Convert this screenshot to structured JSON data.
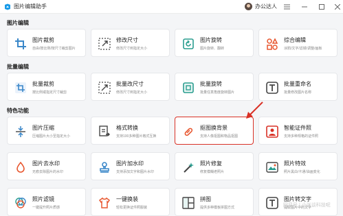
{
  "app": {
    "title": "图片编辑助手",
    "user": "办公达人"
  },
  "colors": {
    "accent": "#e8562e",
    "highlight": "#d93025"
  },
  "sections": [
    {
      "title": "图片编辑",
      "items": [
        {
          "title": "图片裁剪",
          "desc": "自由/按比例/按尺寸裁剪图片",
          "icon": "crop-icon"
        },
        {
          "title": "修改尺寸",
          "desc": "修改尺寸到指定大小",
          "icon": "resize-icon"
        },
        {
          "title": "图片旋转",
          "desc": "图片旋转、翻转",
          "icon": "rotate-icon"
        },
        {
          "title": "综合编辑",
          "desc": "涂鸦/文字/滤镜/调整/画板",
          "icon": "shapes-icon"
        }
      ]
    },
    {
      "title": "批量编辑",
      "items": [
        {
          "title": "批量裁剪",
          "desc": "按比例或指定尺寸裁剪",
          "icon": "batch-crop-icon"
        },
        {
          "title": "批量改尺寸",
          "desc": "修改尺寸到指定大小",
          "icon": "batch-resize-icon"
        },
        {
          "title": "批量旋转",
          "desc": "批量任意角度旋转图片",
          "icon": "batch-rotate-icon"
        },
        {
          "title": "批量重命名",
          "desc": "批量修改图片名称",
          "icon": "rename-icon"
        }
      ]
    },
    {
      "title": "特色功能",
      "items": [
        {
          "title": "图片压缩",
          "desc": "压缩图片大小至指定大小",
          "icon": "compress-icon"
        },
        {
          "title": "格式转换",
          "desc": "支持100多种图片格式互换",
          "icon": "convert-icon"
        },
        {
          "title": "抠图换背景",
          "desc": "支持人像抠图和物品抠图",
          "icon": "cutout-icon"
        },
        {
          "title": "智能证件照",
          "desc": "支持多种规格的证件照",
          "icon": "id-photo-icon"
        },
        {
          "title": "图片去水印",
          "desc": "无痕去除图片的水印",
          "icon": "watermark-remove-icon"
        },
        {
          "title": "图片加水印",
          "desc": "支持添加文字和图片水印",
          "icon": "stamp-icon"
        },
        {
          "title": "照片修复",
          "desc": "修复模糊老照片",
          "icon": "magic-wand-icon"
        },
        {
          "title": "照片特效",
          "desc": "照片黑白/卡通/油画变化",
          "icon": "effects-icon"
        },
        {
          "title": "照片滤镜",
          "desc": "一键提升照片质感",
          "icon": "filter-icon"
        },
        {
          "title": "一键换装",
          "desc": "轻松更换证件照服装",
          "icon": "shirt-icon"
        },
        {
          "title": "拼图",
          "desc": "提供多种模板拼图方式",
          "icon": "collage-icon"
        },
        {
          "title": "图片转文字",
          "desc": "提取图片中的文字",
          "icon": "ocr-icon"
        }
      ]
    }
  ],
  "watermark": "网易号 | 小张谈科技呢"
}
